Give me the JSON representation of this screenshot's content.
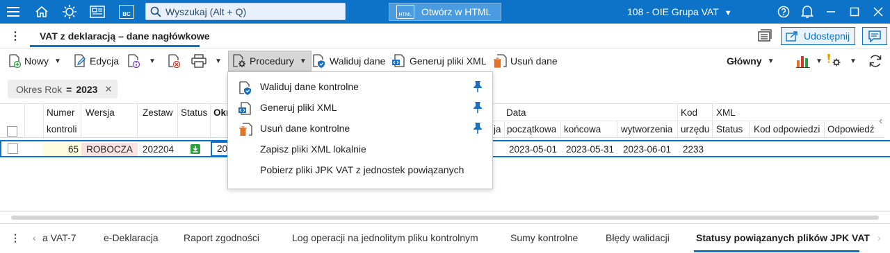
{
  "topbar": {
    "search_placeholder": "Wyszukaj (Alt + Q)",
    "open_html_label": "Otwórz w HTML",
    "html_icon_text": "HTML",
    "bc_icon_text": "BC",
    "company": "108 - OIE Grupa VAT"
  },
  "page": {
    "title": "VAT z deklaracją – dane nagłówkowe",
    "share_label": "Udostępnij"
  },
  "toolbar": {
    "new_label": "Nowy",
    "edit_label": "Edycja",
    "procedures_label": "Procedury",
    "validate_label": "Waliduj dane",
    "generate_label": "Generuj pliki XML",
    "delete_label": "Usuń dane",
    "view_label": "Główny"
  },
  "filter": {
    "name": "Okres Rok",
    "operator": "=",
    "value": "2023"
  },
  "grid": {
    "group_headers": {
      "data": "Data",
      "kod": "Kod",
      "xml": "XML"
    },
    "columns": {
      "numer_1": "Numer",
      "numer_2": "kontroli",
      "wersja": "Wersja",
      "zestaw": "Zestaw",
      "status": "Status",
      "okres": "Okr",
      "ja": "ja",
      "poczatkowa": "początkowa",
      "koncowa": "końcowa",
      "wytworzenia": "wytworzenia",
      "urzedu": "urzędu",
      "xml_status": "Status",
      "kod_odpowiedzi": "Kod odpowiedzi",
      "odpowiedz": "Odpowiedź"
    },
    "rows": [
      {
        "numer": "65",
        "wersja": "ROBOCZA",
        "zestaw": "202204",
        "okres": "20",
        "poczatkowa": "2023-05-01",
        "koncowa": "2023-05-31",
        "wytworzenia": "2023-06-01",
        "urzad": "2233"
      }
    ]
  },
  "procedures_menu": [
    {
      "label": "Waliduj dane kontrolne",
      "icon": "shield-doc-icon",
      "pinned": true
    },
    {
      "label": "Generuj pliki XML",
      "icon": "xml-doc-icon",
      "pinned": true
    },
    {
      "label": "Usuń dane kontrolne",
      "icon": "trash-doc-icon",
      "pinned": true
    },
    {
      "label": "Zapisz pliki XML lokalnie",
      "icon": "",
      "pinned": false
    },
    {
      "label": "Pobierz pliki JPK VAT z jednostek powiązanych",
      "icon": "",
      "pinned": false
    }
  ],
  "bottom_tabs": [
    "a VAT-7",
    "e-Deklaracja",
    "Raport zgodności",
    "Log operacji na jednolitym pliku kontrolnym",
    "Sumy kontrolne",
    "Błędy walidacji",
    "Statusy powiązanych plików JPK VAT"
  ],
  "colors": {
    "brand": "#0d73c8",
    "numer_cell_bg": "#fffde0",
    "wersja_cell_bg": "#fbe3e3",
    "status_icon": "#2e9e3e"
  }
}
